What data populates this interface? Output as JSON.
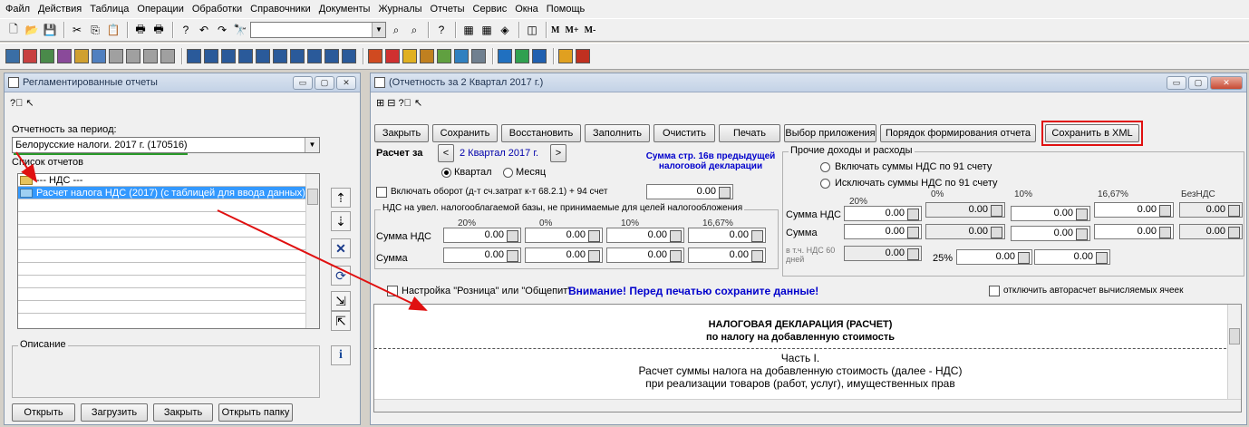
{
  "menu": [
    "Файл",
    "Действия",
    "Таблица",
    "Операции",
    "Обработки",
    "Справочники",
    "Документы",
    "Журналы",
    "Отчеты",
    "Сервис",
    "Окна",
    "Помощь"
  ],
  "toolbar": {
    "m_labels": [
      "M",
      "M+",
      "M-"
    ]
  },
  "left": {
    "title": "Регламентированные отчеты",
    "period_label": "Отчетность за период:",
    "period_value": "Белорусские налоги. 2017 г. (170516)",
    "list_label": "Список отчетов",
    "rows": [
      "--- НДС ---",
      "Расчет налога НДС (2017) (с таблицей для ввода данных)"
    ],
    "desc_label": "Описание",
    "buttons": [
      "Открыть",
      "Загрузить",
      "Закрыть",
      "Открыть папку"
    ]
  },
  "right": {
    "title": "(Отчетность за 2 Квартал 2017 г.)",
    "buttons": [
      "Закрыть",
      "Сохранить",
      "Восстановить",
      "Заполнить",
      "Очистить",
      "Печать",
      "Выбор приложения",
      "Порядок формирования отчета",
      "Сохранить в XML"
    ],
    "raschet_label": "Расчет за",
    "period": "2 Квартал 2017 г.",
    "sum_note": "Сумма стр. 16в предыдущей налоговой декларации",
    "radio_q": "Квартал",
    "radio_m": "Месяц",
    "oborot_label": "Включать оборот (д-т сч.затрат к-т 68.2.1) + 94 счет",
    "oborot_value": "0.00",
    "nds_group": "НДС на увел. налогооблагаемой базы, не принимаемые для целей налогообложения",
    "rates": [
      "20%",
      "0%",
      "10%",
      "16,67%"
    ],
    "row_nds": "Сумма НДС",
    "row_sum": "Сумма",
    "zero": "0.00",
    "prochie_group": "Прочие доходы и расходы",
    "incl91": "Включать суммы НДС по 91 счету",
    "excl91": "Исключать суммы НДС по 91 счету",
    "rates2": [
      "20%",
      "0%",
      "10%",
      "16,67%",
      "БезНДС"
    ],
    "vtch": "в т.ч. НДС 60 дней",
    "rate25": "25%",
    "roznica": "Настройка \"Розница\" или \"Общепит\"",
    "warning": "Внимание! Перед печатью сохраните данные!",
    "autocalc": "отключить авторасчет вычисляемых ячеек",
    "doc": {
      "title1": "НАЛОГОВАЯ ДЕКЛАРАЦИЯ (РАСЧЕТ)",
      "title2": "по налогу на добавленную стоимость",
      "part": "Часть I.",
      "line1": "Расчет суммы налога на добавленную стоимость (далее - НДС)",
      "line2": "при реализации товаров (работ, услуг), имущественных прав"
    }
  },
  "colors": {
    "accent_red": "#e01010",
    "selection": "#3399ff",
    "warning_blue": "#0000cc"
  }
}
